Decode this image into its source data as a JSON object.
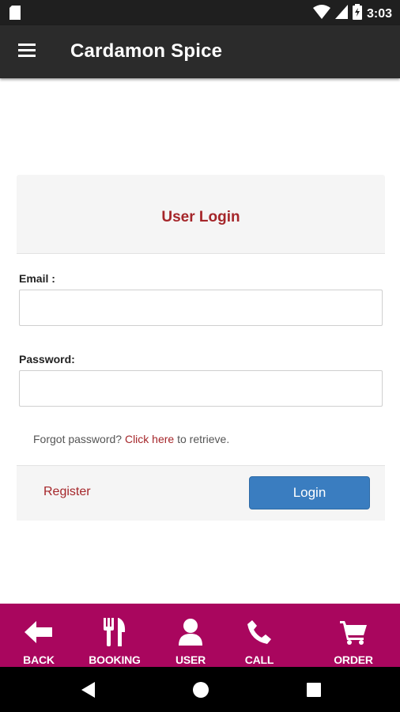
{
  "status_bar": {
    "time": "3:03",
    "icons": [
      "sd-card-icon",
      "wifi-icon",
      "signal-icon",
      "battery-icon"
    ]
  },
  "app_bar": {
    "title": "Cardamon Spice",
    "menu_icon": "hamburger-menu-icon"
  },
  "login": {
    "title": "User Login",
    "email_label": "Email :",
    "email_value": "",
    "password_label": "Password:",
    "password_value": "",
    "forgot_prefix": "Forgot password?",
    "forgot_link": "Click here",
    "forgot_suffix": "to retrieve.",
    "register_label": "Register",
    "login_label": "Login"
  },
  "bottom_nav": {
    "items": [
      {
        "label": "BACK",
        "icon": "arrow-left-icon"
      },
      {
        "label": "BOOKING",
        "icon": "fork-knife-icon"
      },
      {
        "label": "USER",
        "icon": "user-icon"
      },
      {
        "label": "CALL",
        "icon": "phone-icon"
      },
      {
        "label": "ORDER",
        "icon": "cart-icon"
      }
    ]
  },
  "system_nav": {
    "icons": [
      "back-triangle-icon",
      "home-circle-icon",
      "recents-square-icon"
    ]
  },
  "colors": {
    "status_bar": "#1f1f1f",
    "app_bar": "#2b2b2b",
    "accent_red": "#a5262a",
    "login_button": "#3a7dc0",
    "bottom_nav": "#a9065e",
    "system_nav": "#000000"
  }
}
